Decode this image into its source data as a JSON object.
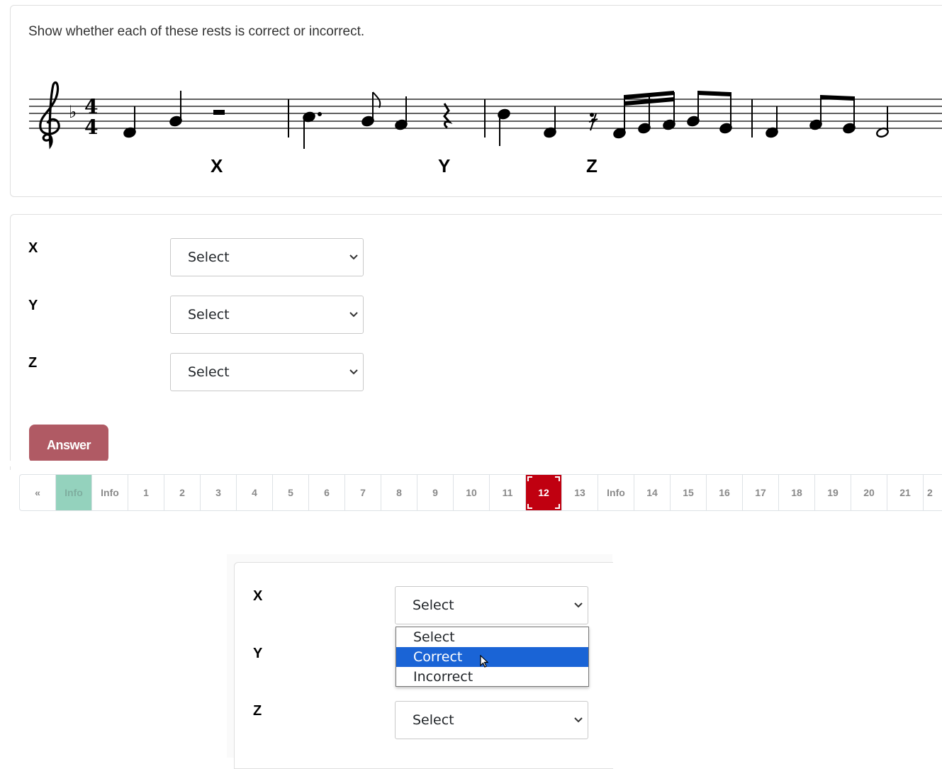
{
  "question": {
    "text": "Show whether each of these rests is correct or incorrect.",
    "rest_labels": [
      "X",
      "Y",
      "Z"
    ]
  },
  "answer_form": {
    "rows": [
      {
        "label": "X",
        "value": "Select"
      },
      {
        "label": "Y",
        "value": "Select"
      },
      {
        "label": "Z",
        "value": "Select"
      }
    ],
    "answer_button": "Answer"
  },
  "pagination": {
    "prev": "«",
    "items": [
      "Info",
      "Info",
      "1",
      "2",
      "3",
      "4",
      "5",
      "6",
      "7",
      "8",
      "9",
      "10",
      "11",
      "12",
      "13",
      "Info",
      "14",
      "15",
      "16",
      "17",
      "18",
      "19",
      "20",
      "21",
      "2"
    ],
    "current": "12",
    "colors": {
      "current": "#c00010",
      "visited_info": "#94d2bd"
    }
  },
  "zoomed_form": {
    "rows": [
      {
        "label": "X",
        "value": "Select"
      },
      {
        "label": "Y"
      },
      {
        "label": "Z",
        "value": "Select"
      }
    ],
    "dropdown_options": [
      "Select",
      "Correct",
      "Incorrect"
    ],
    "highlighted_option": "Correct"
  },
  "colors": {
    "answer_button": "#b05a64",
    "dropdown_highlight": "#1a64d6"
  }
}
